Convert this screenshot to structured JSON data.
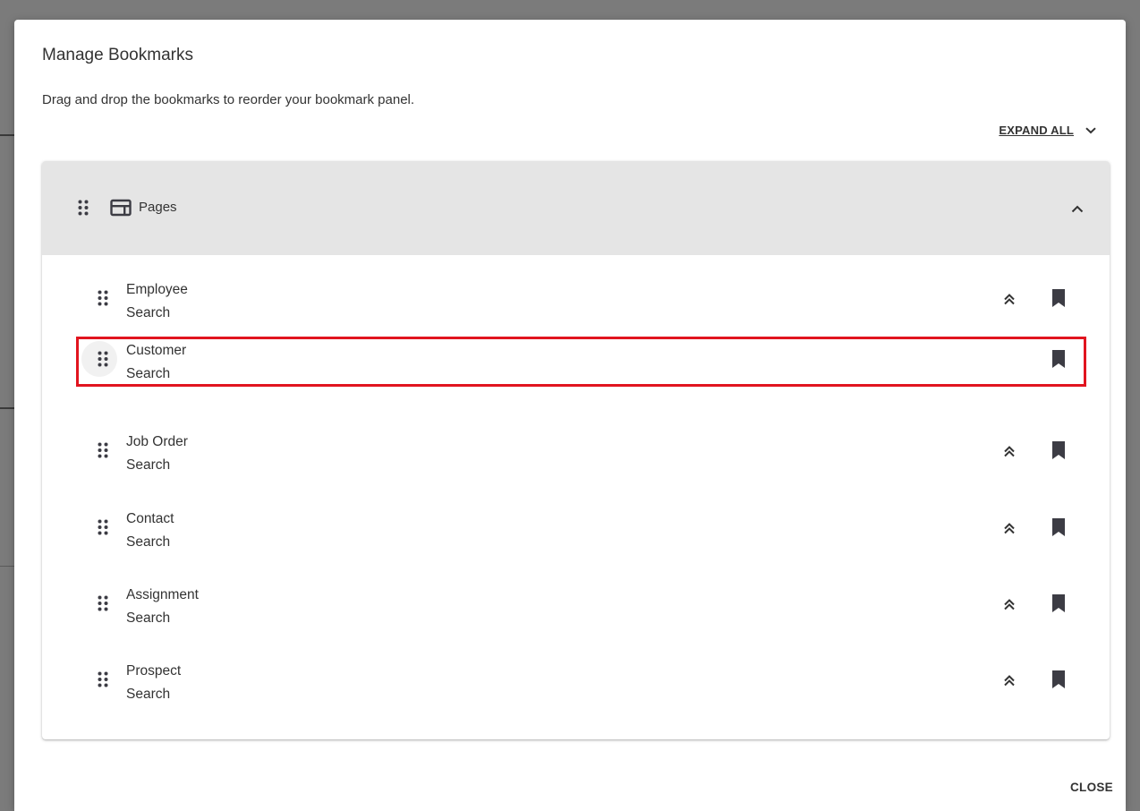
{
  "dialog": {
    "title": "Manage Bookmarks",
    "subtitle": "Drag and drop the bookmarks to reorder your bookmark panel.",
    "expand_all_label": "EXPAND ALL",
    "close_label": "CLOSE"
  },
  "group": {
    "title": "Pages",
    "icon": "web-page-icon",
    "expanded": true
  },
  "bookmarks": [
    {
      "line1": "Employee",
      "line2": "Search",
      "move_to_top": true
    },
    {
      "line1": "Customer",
      "line2": "Search",
      "move_to_top": false,
      "highlighted": true
    },
    {
      "line1": "Job Order",
      "line2": "Search",
      "move_to_top": true
    },
    {
      "line1": "Contact",
      "line2": "Search",
      "move_to_top": true
    },
    {
      "line1": "Assignment",
      "line2": "Search",
      "move_to_top": true
    },
    {
      "line1": "Prospect",
      "line2": "Search",
      "move_to_top": true
    }
  ],
  "colors": {
    "highlight_border": "#e1141f",
    "group_header_bg": "#e5e5e5",
    "icon": "#3c3c44",
    "overlay": "#7b7b7b"
  }
}
